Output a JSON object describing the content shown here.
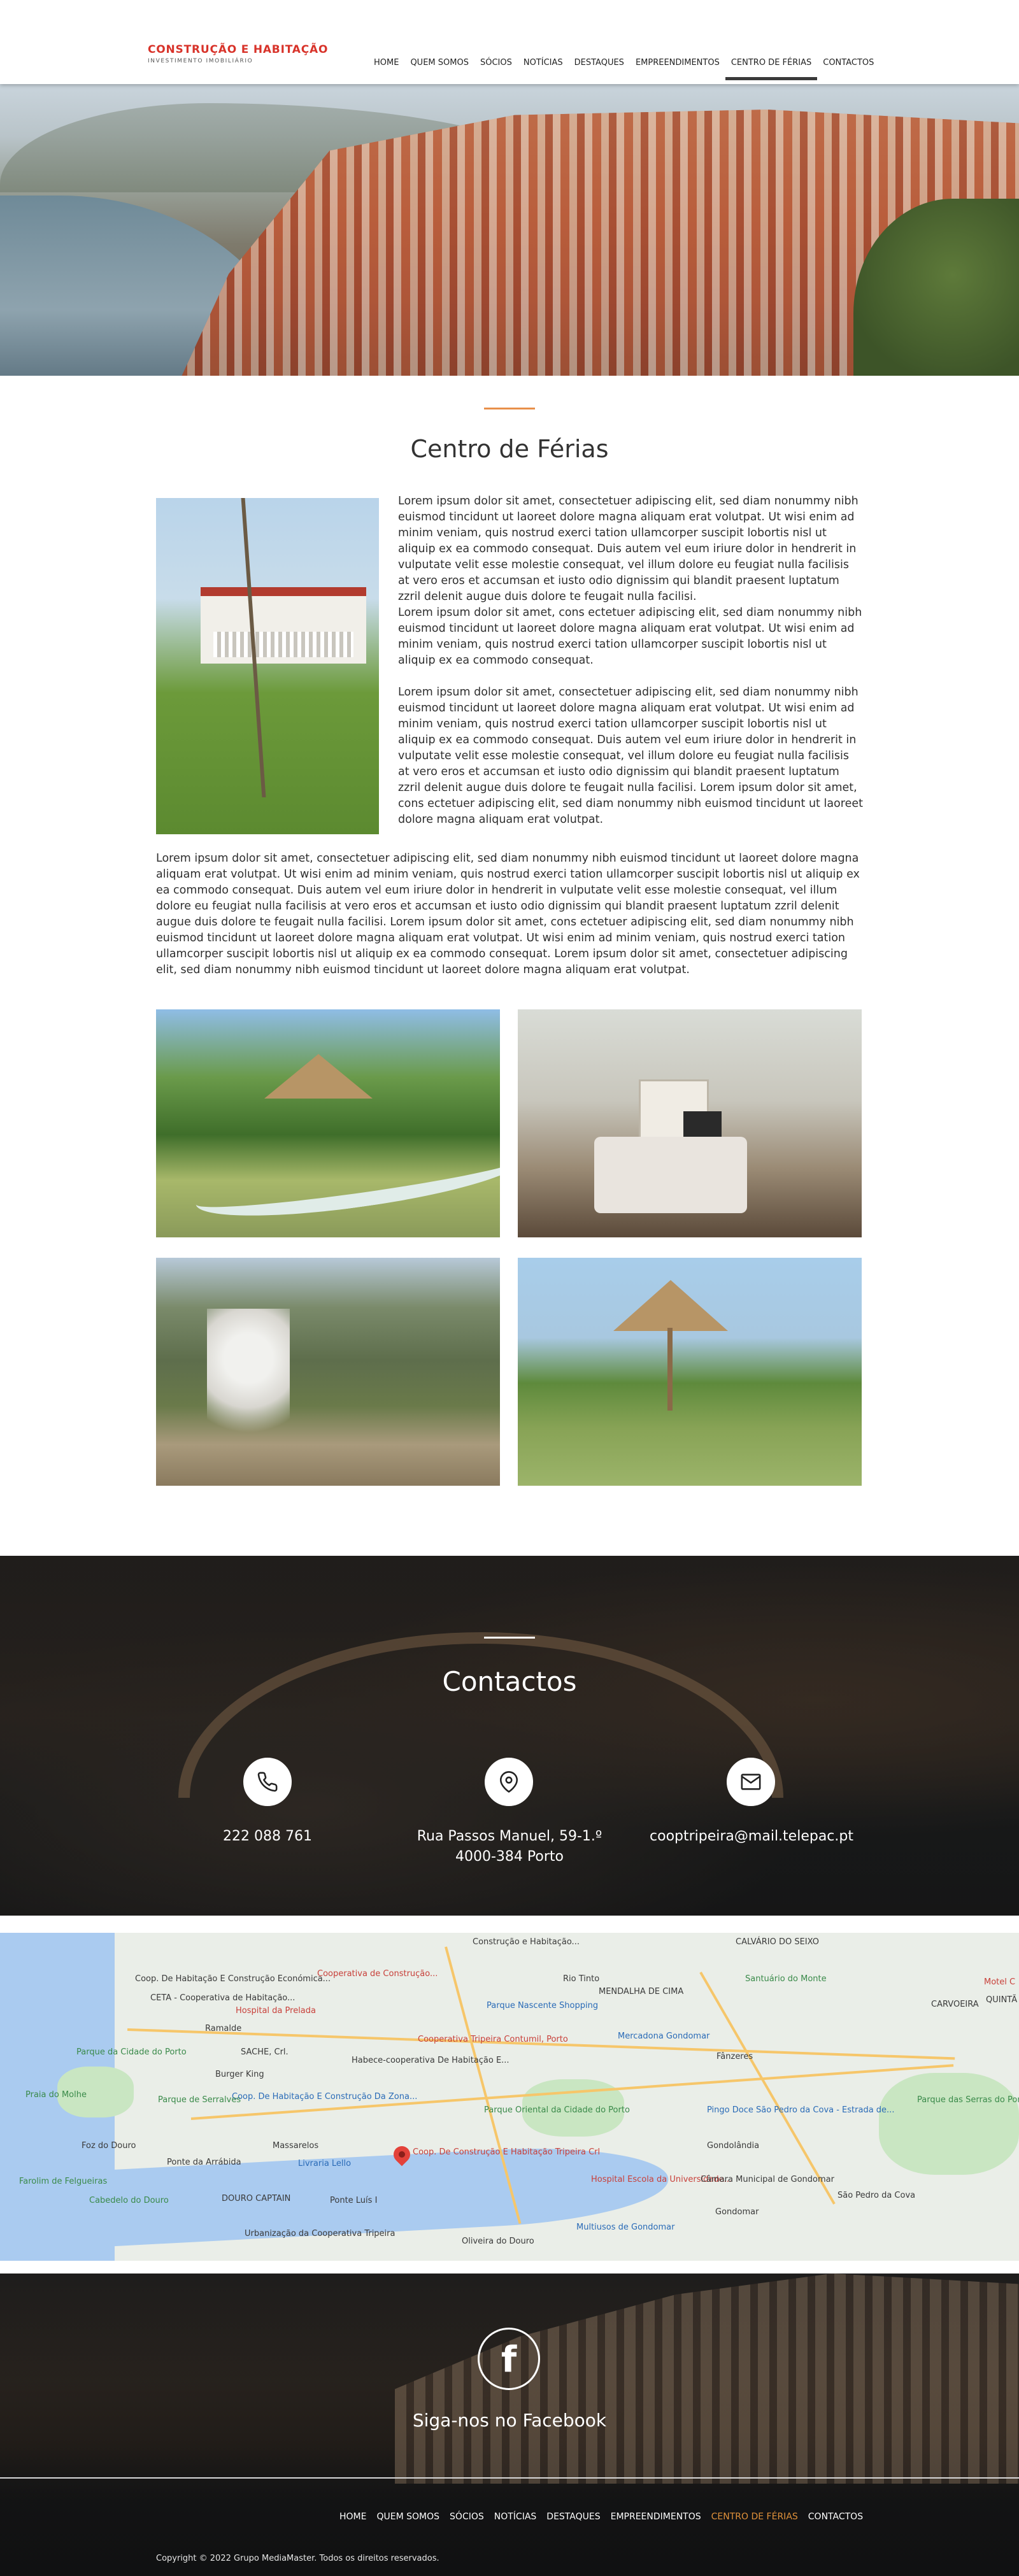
{
  "header": {
    "logo_title": "CONSTRUÇÃO E HABITAÇÃO",
    "logo_subtitle": "INVESTIMENTO IMOBILIÁRIO",
    "nav": [
      "HOME",
      "QUEM SOMOS",
      "SÓCIOS",
      "NOTÍCIAS",
      "DESTAQUES",
      "EMPREENDIMENTOS",
      "CENTRO DE FÉRIAS",
      "CONTACTOS"
    ],
    "active": "CENTRO DE FÉRIAS"
  },
  "main": {
    "title": "Centro de Férias",
    "para1": "Lorem ipsum dolor sit amet, consectetuer adipiscing elit, sed diam nonummy nibh euismod tincidunt ut laoreet dolore magna aliquam erat volutpat. Ut wisi enim ad minim veniam, quis nostrud exerci tation ullamcorper suscipit lobortis nisl ut aliquip ex ea commodo consequat. Duis autem vel eum iriure dolor in hendrerit in vulputate velit esse molestie consequat, vel illum dolore eu feugiat nulla facilisis at vero eros et accumsan et iusto odio dignissim qui blandit praesent luptatum zzril delenit augue duis dolore te feugait nulla facilisi.",
    "para2": "Lorem ipsum dolor sit amet, cons ectetuer adipiscing elit, sed diam nonummy nibh euismod tincidunt ut laoreet dolore magna aliquam erat volutpat. Ut wisi enim ad minim veniam, quis nostrud exerci tation ullamcorper suscipit lobortis nisl ut aliquip ex ea commodo consequat.",
    "para3": "Lorem ipsum dolor sit amet, consectetuer adipiscing elit, sed diam nonummy nibh euismod tincidunt ut laoreet dolore magna aliquam erat volutpat. Ut wisi enim ad minim veniam, quis nostrud exerci tation ullamcorper suscipit lobortis nisl ut aliquip ex ea commodo consequat. Duis autem vel eum iriure dolor in hendrerit in vulputate velit esse molestie consequat, vel illum dolore eu feugiat nulla facilisis at vero eros et accumsan et iusto odio dignissim qui blandit praesent luptatum zzril delenit augue duis dolore te feugait nulla facilisi. Lorem ipsum dolor sit amet, cons ectetuer adipiscing elit, sed diam nonummy nibh euismod tincidunt ut laoreet dolore magna aliquam erat volutpat.",
    "para4": "Lorem ipsum dolor sit amet, consectetuer adipiscing elit, sed diam nonummy nibh euismod tincidunt ut laoreet dolore magna aliquam erat volutpat. Ut wisi enim ad minim veniam, quis nostrud exerci tation ullamcorper suscipit lobortis nisl ut aliquip ex ea commodo consequat. Duis autem vel eum iriure dolor in hendrerit in vulputate velit esse molestie consequat, vel illum dolore eu feugiat nulla facilisis at vero eros et accumsan et iusto odio dignissim qui blandit praesent luptatum zzril delenit augue duis dolore te feugait nulla facilisi. Lorem ipsum dolor sit amet, cons ectetuer adipiscing elit, sed diam nonummy nibh euismod tincidunt ut laoreet dolore magna aliquam erat volutpat. Ut wisi enim ad minim veniam, quis nostrud exerci tation ullamcorper suscipit lobortis nisl ut aliquip ex ea commodo consequat. Lorem ipsum dolor sit amet, consectetuer adipiscing elit, sed diam nonummy nibh euismod tincidunt ut laoreet dolore magna aliquam erat volutpat."
  },
  "contacts": {
    "title": "Contactos",
    "phone": "222 088 761",
    "address_line1": "Rua Passos Manuel, 59-1.º",
    "address_line2": "4000-384 Porto",
    "email": "cooptripeira@mail.telepac.pt",
    "icons": [
      "phone-icon",
      "location-icon",
      "email-icon"
    ]
  },
  "map": {
    "labels": [
      "Coop. De Habitação E Construção Económica...",
      "Cooperativa de Construção...",
      "Construção e Habitação...",
      "CALVÁRIO DO SEIXO",
      "CETA - Cooperativa de Habitação...",
      "Hospital da Prelada",
      "Rio Tinto",
      "MENDALHA DE CIMA",
      "Santuário do Monte",
      "Ramalde",
      "SACHE, Crl.",
      "Habece-cooperativa De Habitação E...",
      "Cooperativa Tripeira Contumil, Porto",
      "Parque Nascente Shopping",
      "Mercadona Gondomar",
      "Fânzeres",
      "Parque da Cidade do Porto",
      "Burger King",
      "Coop. De Habitação E Construção Da Zona...",
      "Parque Oriental da Cidade do Porto",
      "Pingo Doce São Pedro da Cova - Estrada de...",
      "Parque das Serras do Porto",
      "Praia do Molhe",
      "Parque de Serralves",
      "Foz do Douro",
      "Massarelos",
      "Coop. De Construção E Habitação Tripeira Crl",
      "Gondolândia",
      "Ponte da Arrábida",
      "Livraria Lello",
      "Hospital Escola da Universidade...",
      "Câmara Municipal de Gondomar",
      "Farolim de Felgueiras",
      "Cabedelo do Douro",
      "DOURO CAPTAIN",
      "Ponte Luís I",
      "Gondomar",
      "São Pedro da Cova",
      "Urbanização da Cooperativa Tripeira",
      "Oliveira do Douro",
      "Multiusos de Gondomar",
      "CARVOEIRA",
      "Motel C",
      "QUINTÃ DE CIMA"
    ]
  },
  "facebook": {
    "text": "Siga-nos no Facebook",
    "icon_letter": "f"
  },
  "footer": {
    "nav": [
      "HOME",
      "QUEM SOMOS",
      "SÓCIOS",
      "NOTÍCIAS",
      "DESTAQUES",
      "EMPREENDIMENTOS",
      "CENTRO DE FÉRIAS",
      "CONTACTOS"
    ],
    "active": "CENTRO DE FÉRIAS",
    "copyright": "Copyright © 2022 Grupo MediaMaster. Todos os direitos reservados."
  },
  "colors": {
    "brand_red": "#d8332a",
    "accent_orange": "#e8904a",
    "footer_active": "#e0913a"
  }
}
